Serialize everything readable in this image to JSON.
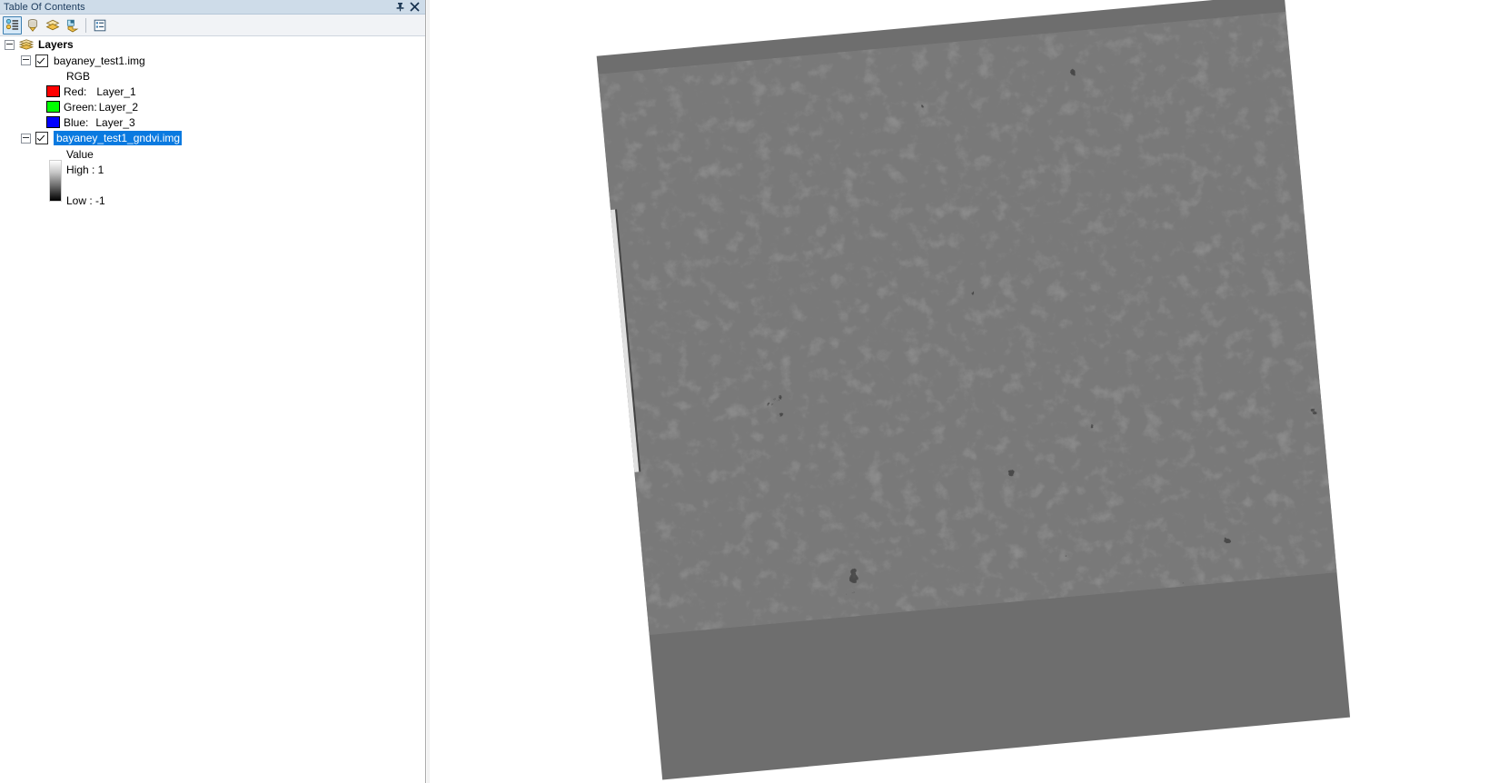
{
  "panel": {
    "title": "Table Of Contents",
    "pin_icon": "pin-icon",
    "close_icon": "close-icon",
    "toolbar": {
      "buttons": [
        {
          "name": "list-by-drawing-order-button",
          "tooltip": "List By Drawing Order",
          "active": true
        },
        {
          "name": "list-by-source-button",
          "tooltip": "List By Source",
          "active": false
        },
        {
          "name": "list-by-visibility-button",
          "tooltip": "List By Visibility",
          "active": false
        },
        {
          "name": "list-by-selection-button",
          "tooltip": "List By Selection",
          "active": false
        },
        {
          "name": "options-button",
          "tooltip": "Options",
          "active": false
        }
      ]
    }
  },
  "tree": {
    "root": {
      "label": "Layers",
      "icon": "layers-icon",
      "expanded": true
    },
    "layer1": {
      "label": "bayaney_test1.img",
      "checked": true,
      "expanded": true,
      "renderer_label": "RGB",
      "bands": [
        {
          "channel": "Red:",
          "band": "Layer_1",
          "color": "#ff0000"
        },
        {
          "channel": "Green:",
          "band": "Layer_2",
          "color": "#00ff00"
        },
        {
          "channel": "Blue:",
          "band": "Layer_3",
          "color": "#0000ff"
        }
      ]
    },
    "layer2": {
      "label": "bayaney_test1_gndvi.img",
      "checked": true,
      "expanded": true,
      "selected": true,
      "selection_color": "#0a7ae0",
      "symbology_label": "Value",
      "high_label": "High : 1",
      "low_label": "Low : -1",
      "ramp_top_color": "#ffffff",
      "ramp_bottom_color": "#000000"
    }
  },
  "map": {
    "background_color": "#ffffff",
    "nodata_color": "#6e6e6e",
    "raster_name": "bayaney_test1_gndvi.img",
    "rotation_note": "raster footprint rotated approx 5 degrees counter-clockwise"
  }
}
